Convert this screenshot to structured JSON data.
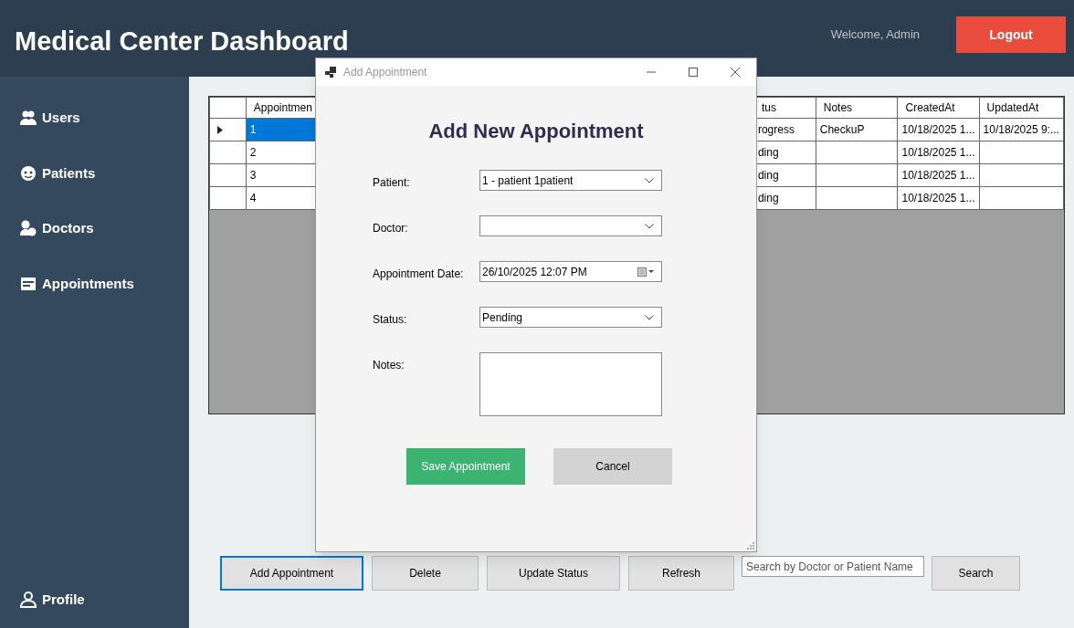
{
  "header": {
    "title": "Medical Center Dashboard",
    "welcome": "Welcome, Admin",
    "logout": "Logout"
  },
  "sidebar": {
    "items": [
      {
        "label": "Users"
      },
      {
        "label": "Patients"
      },
      {
        "label": "Doctors"
      },
      {
        "label": "Appointments"
      }
    ],
    "footer": {
      "label": "Profile"
    }
  },
  "table": {
    "columns": [
      "Appointmen",
      "tus",
      "Notes",
      "CreatedAt",
      "UpdatedAt"
    ],
    "rows": [
      {
        "selected": true,
        "cells": [
          "1",
          "rogress",
          "CheckuP",
          "10/18/2025 1...",
          "10/18/2025 9:..."
        ]
      },
      {
        "selected": false,
        "cells": [
          "2",
          "ding",
          null,
          "10/18/2025 1...",
          null
        ]
      },
      {
        "selected": false,
        "cells": [
          "3",
          "ding",
          null,
          "10/18/2025 1...",
          null
        ]
      },
      {
        "selected": false,
        "cells": [
          "4",
          "ding",
          null,
          "10/18/2025 1...",
          null
        ]
      }
    ]
  },
  "actions": [
    {
      "label": "Add Appointment",
      "focused": true
    },
    {
      "label": "Delete",
      "focused": false
    },
    {
      "label": "Update Status",
      "focused": false
    },
    {
      "label": "Refresh",
      "focused": false
    }
  ],
  "search": {
    "placeholder": "Search by Doctor or Patient Name",
    "button": "Search"
  },
  "dialog": {
    "title": "Add Appointment",
    "heading": "Add New Appointment",
    "fields": [
      {
        "kind": "combo",
        "label": "Patient:",
        "value": "1 - patient 1patient"
      },
      {
        "kind": "combo",
        "label": "Doctor:"
      },
      {
        "kind": "date",
        "label": "Appointment Date:",
        "value": "26/10/2025 12:07 PM"
      },
      {
        "kind": "combo",
        "label": "Status:",
        "value": "Pending"
      },
      {
        "kind": "memo",
        "label": "Notes:"
      }
    ],
    "save": "Save Appointment",
    "cancel": "Cancel"
  }
}
